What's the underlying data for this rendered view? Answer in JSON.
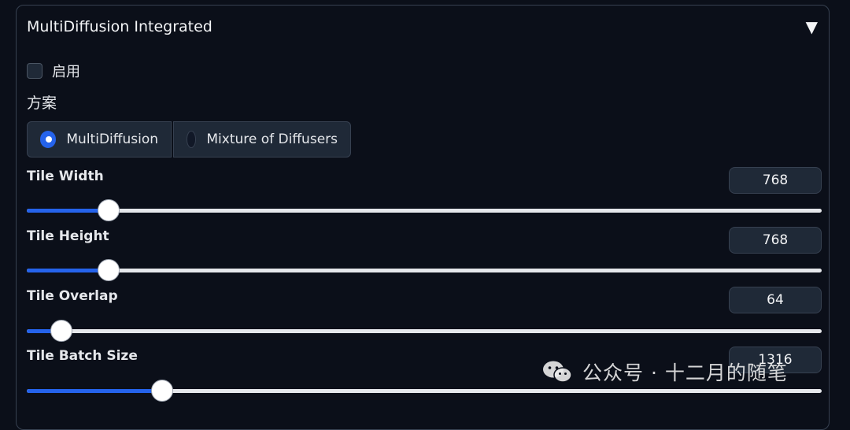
{
  "panel": {
    "title": "MultiDiffusion Integrated",
    "collapse_icon": "▼",
    "enable_label": "启用",
    "scheme_label": "方案",
    "scheme_options": [
      "MultiDiffusion",
      "Mixture of Diffusers"
    ],
    "scheme_selected": "MultiDiffusion"
  },
  "sliders": [
    {
      "label": "Tile Width",
      "value": "768",
      "fraction": 0.103
    },
    {
      "label": "Tile Height",
      "value": "768",
      "fraction": 0.103
    },
    {
      "label": "Tile Overlap",
      "value": "64",
      "fraction": 0.044
    },
    {
      "label": "Tile Batch Size",
      "value": "1316",
      "fraction": 0.17
    }
  ],
  "watermark": {
    "text": "公众号 · 十二月的随笔",
    "icon": "wechat-icon"
  },
  "colors": {
    "accent": "#2563eb",
    "background": "#0b0f19",
    "surface": "#1f2937",
    "border": "#374151"
  }
}
